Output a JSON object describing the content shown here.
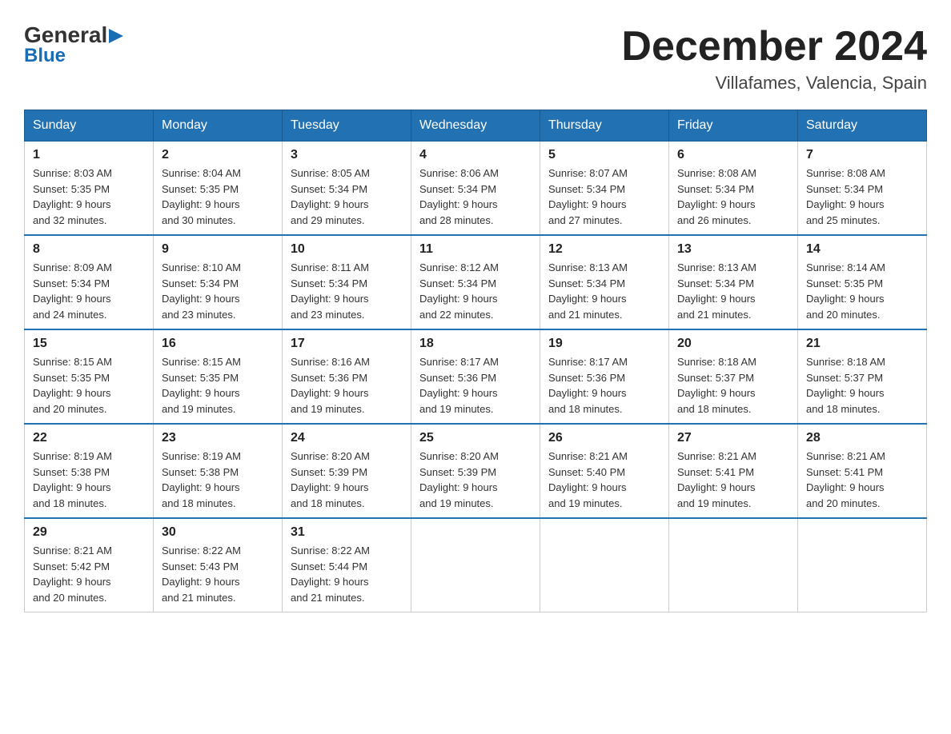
{
  "logo": {
    "general": "General",
    "blue": "Blue",
    "arrow": "▶"
  },
  "title": {
    "month_year": "December 2024",
    "location": "Villafames, Valencia, Spain"
  },
  "weekdays": [
    "Sunday",
    "Monday",
    "Tuesday",
    "Wednesday",
    "Thursday",
    "Friday",
    "Saturday"
  ],
  "weeks": [
    [
      {
        "day": "1",
        "sunrise": "8:03 AM",
        "sunset": "5:35 PM",
        "daylight": "9 hours and 32 minutes."
      },
      {
        "day": "2",
        "sunrise": "8:04 AM",
        "sunset": "5:35 PM",
        "daylight": "9 hours and 30 minutes."
      },
      {
        "day": "3",
        "sunrise": "8:05 AM",
        "sunset": "5:34 PM",
        "daylight": "9 hours and 29 minutes."
      },
      {
        "day": "4",
        "sunrise": "8:06 AM",
        "sunset": "5:34 PM",
        "daylight": "9 hours and 28 minutes."
      },
      {
        "day": "5",
        "sunrise": "8:07 AM",
        "sunset": "5:34 PM",
        "daylight": "9 hours and 27 minutes."
      },
      {
        "day": "6",
        "sunrise": "8:08 AM",
        "sunset": "5:34 PM",
        "daylight": "9 hours and 26 minutes."
      },
      {
        "day": "7",
        "sunrise": "8:08 AM",
        "sunset": "5:34 PM",
        "daylight": "9 hours and 25 minutes."
      }
    ],
    [
      {
        "day": "8",
        "sunrise": "8:09 AM",
        "sunset": "5:34 PM",
        "daylight": "9 hours and 24 minutes."
      },
      {
        "day": "9",
        "sunrise": "8:10 AM",
        "sunset": "5:34 PM",
        "daylight": "9 hours and 23 minutes."
      },
      {
        "day": "10",
        "sunrise": "8:11 AM",
        "sunset": "5:34 PM",
        "daylight": "9 hours and 23 minutes."
      },
      {
        "day": "11",
        "sunrise": "8:12 AM",
        "sunset": "5:34 PM",
        "daylight": "9 hours and 22 minutes."
      },
      {
        "day": "12",
        "sunrise": "8:13 AM",
        "sunset": "5:34 PM",
        "daylight": "9 hours and 21 minutes."
      },
      {
        "day": "13",
        "sunrise": "8:13 AM",
        "sunset": "5:34 PM",
        "daylight": "9 hours and 21 minutes."
      },
      {
        "day": "14",
        "sunrise": "8:14 AM",
        "sunset": "5:35 PM",
        "daylight": "9 hours and 20 minutes."
      }
    ],
    [
      {
        "day": "15",
        "sunrise": "8:15 AM",
        "sunset": "5:35 PM",
        "daylight": "9 hours and 20 minutes."
      },
      {
        "day": "16",
        "sunrise": "8:15 AM",
        "sunset": "5:35 PM",
        "daylight": "9 hours and 19 minutes."
      },
      {
        "day": "17",
        "sunrise": "8:16 AM",
        "sunset": "5:36 PM",
        "daylight": "9 hours and 19 minutes."
      },
      {
        "day": "18",
        "sunrise": "8:17 AM",
        "sunset": "5:36 PM",
        "daylight": "9 hours and 19 minutes."
      },
      {
        "day": "19",
        "sunrise": "8:17 AM",
        "sunset": "5:36 PM",
        "daylight": "9 hours and 18 minutes."
      },
      {
        "day": "20",
        "sunrise": "8:18 AM",
        "sunset": "5:37 PM",
        "daylight": "9 hours and 18 minutes."
      },
      {
        "day": "21",
        "sunrise": "8:18 AM",
        "sunset": "5:37 PM",
        "daylight": "9 hours and 18 minutes."
      }
    ],
    [
      {
        "day": "22",
        "sunrise": "8:19 AM",
        "sunset": "5:38 PM",
        "daylight": "9 hours and 18 minutes."
      },
      {
        "day": "23",
        "sunrise": "8:19 AM",
        "sunset": "5:38 PM",
        "daylight": "9 hours and 18 minutes."
      },
      {
        "day": "24",
        "sunrise": "8:20 AM",
        "sunset": "5:39 PM",
        "daylight": "9 hours and 18 minutes."
      },
      {
        "day": "25",
        "sunrise": "8:20 AM",
        "sunset": "5:39 PM",
        "daylight": "9 hours and 19 minutes."
      },
      {
        "day": "26",
        "sunrise": "8:21 AM",
        "sunset": "5:40 PM",
        "daylight": "9 hours and 19 minutes."
      },
      {
        "day": "27",
        "sunrise": "8:21 AM",
        "sunset": "5:41 PM",
        "daylight": "9 hours and 19 minutes."
      },
      {
        "day": "28",
        "sunrise": "8:21 AM",
        "sunset": "5:41 PM",
        "daylight": "9 hours and 20 minutes."
      }
    ],
    [
      {
        "day": "29",
        "sunrise": "8:21 AM",
        "sunset": "5:42 PM",
        "daylight": "9 hours and 20 minutes."
      },
      {
        "day": "30",
        "sunrise": "8:22 AM",
        "sunset": "5:43 PM",
        "daylight": "9 hours and 21 minutes."
      },
      {
        "day": "31",
        "sunrise": "8:22 AM",
        "sunset": "5:44 PM",
        "daylight": "9 hours and 21 minutes."
      },
      null,
      null,
      null,
      null
    ]
  ],
  "labels": {
    "sunrise": "Sunrise:",
    "sunset": "Sunset:",
    "daylight": "Daylight:"
  }
}
